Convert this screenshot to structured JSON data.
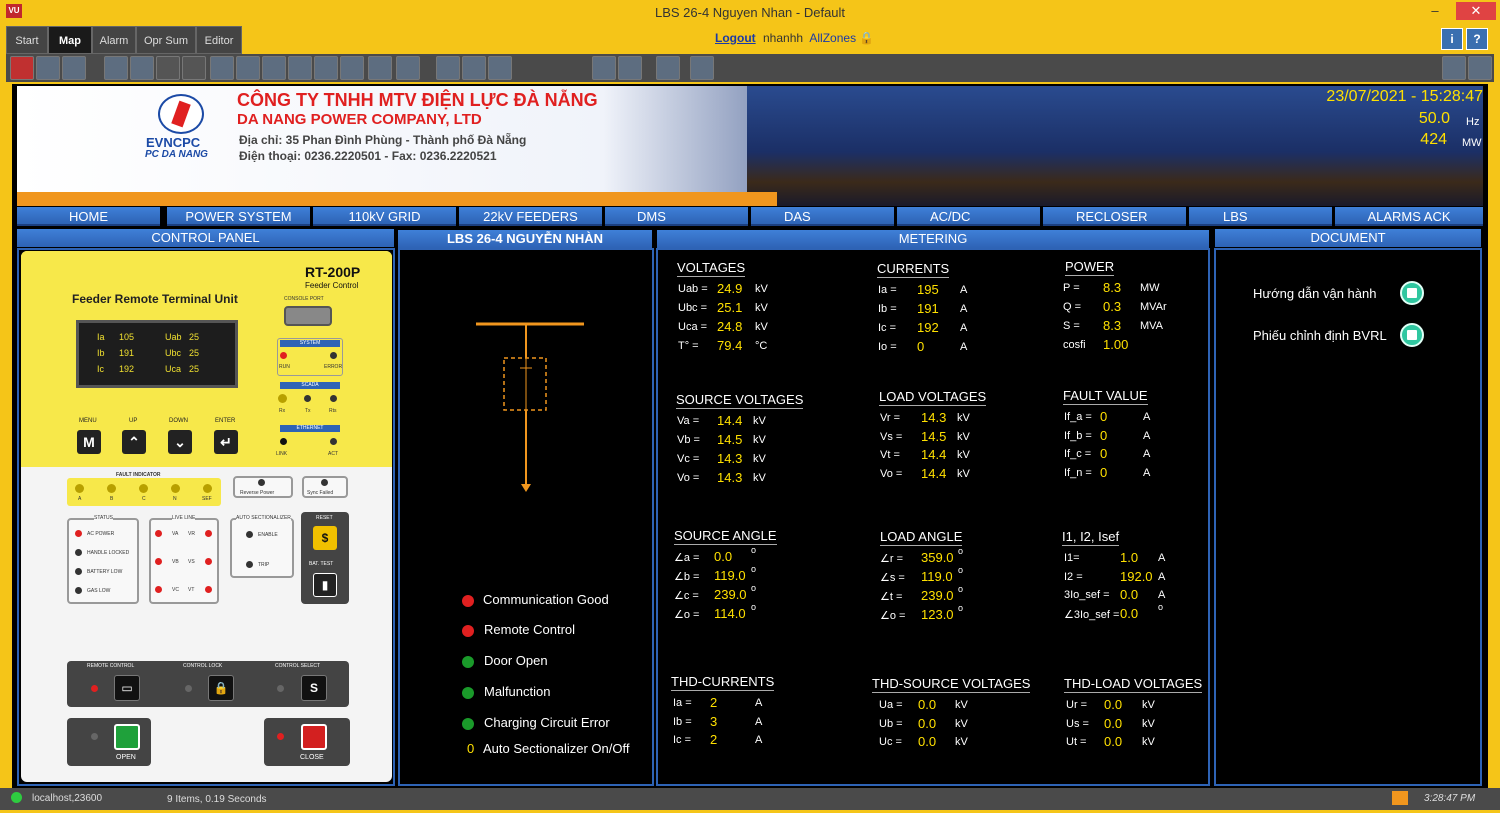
{
  "window": {
    "title": "LBS 26-4 Nguyen Nhan - Default",
    "app_icon": "VU"
  },
  "tabs": [
    {
      "label": "Start"
    },
    {
      "label": "Map"
    },
    {
      "label": "Alarm"
    },
    {
      "label": "Opr Sum"
    },
    {
      "label": "Editor"
    }
  ],
  "user": {
    "logout": "Logout",
    "name": "nhanhh",
    "zones": "AllZones"
  },
  "banner": {
    "company_vn": "CÔNG TY TNHH MTV ĐIỆN LỰC ĐÀ NẴNG",
    "company_en": "DA NANG POWER COMPANY, LTD",
    "address": "Địa chỉ: 35 Phan Đình Phùng - Thành phố Đà Nẵng",
    "phone": "Điện thoại: 0236.2220501 - Fax: 0236.2220521",
    "logo_line1": "EVNCPC",
    "logo_line2": "PC DA NANG",
    "datetime": "23/07/2021 - 15:28:47",
    "freq": "50.0",
    "freq_unit": "Hz",
    "power": "424",
    "power_unit": "MW"
  },
  "nav": [
    {
      "label": "HOME"
    },
    {
      "label": "POWER SYSTEM"
    },
    {
      "label": "110kV GRID"
    },
    {
      "label": "22kV FEEDERS"
    },
    {
      "label": "DMS"
    },
    {
      "label": "DAS"
    },
    {
      "label": "AC/DC"
    },
    {
      "label": "RECLOSER"
    },
    {
      "label": "LBS"
    },
    {
      "label": "ALARMS ACK"
    }
  ],
  "panels": {
    "control": "CONTROL PANEL",
    "device": "LBS 26-4 NGUYỄN NHÀN",
    "metering": "METERING",
    "document": "DOCUMENT"
  },
  "rtu": {
    "title": "Feeder Remote Terminal Unit",
    "model": "RT-200P",
    "model_sub": "Feeder Control",
    "console": "CONSOLE PORT",
    "lcd": [
      {
        "l": "Ia",
        "v": "105",
        "l2": "Uab",
        "v2": "25"
      },
      {
        "l": "Ib",
        "v": "191",
        "l2": "Ubc",
        "v2": "25"
      },
      {
        "l": "Ic",
        "v": "192",
        "l2": "Uca",
        "v2": "25"
      }
    ],
    "keys": [
      {
        "label": "MENU",
        "glyph": "M"
      },
      {
        "label": "UP",
        "glyph": "⌃"
      },
      {
        "label": "DOWN",
        "glyph": "⌄"
      },
      {
        "label": "ENTER",
        "glyph": "↵"
      }
    ],
    "system": "SYSTEM",
    "run": "RUN",
    "error": "ERROR",
    "scada": "SCADA",
    "rx": "Rx",
    "tx": "Tx",
    "rts": "Rts",
    "ethernet": "ETHERNET",
    "link": "LINK",
    "act": "ACT",
    "fault_indicator": "FAULT INDICATOR",
    "fi": [
      "A",
      "B",
      "C",
      "N",
      "SEF"
    ],
    "reverse_power": "Reverse Power",
    "sync_failed": "Sync Failed",
    "status": "STATUS",
    "status_items": [
      "AC POWER",
      "HANDLE LOCKED",
      "BATTERY LOW",
      "GAS LOW"
    ],
    "live_line": "LIVE LINE",
    "ll": [
      "VA",
      "VR",
      "VB",
      "VS",
      "VC",
      "VT"
    ],
    "auto_sec": "AUTO SECTIONALIZER",
    "enable": "ENABLE",
    "trip": "TRIP",
    "reset": "RESET",
    "bat_test": "BAT. TEST",
    "remote_control": "REMOTE CONTROL",
    "control_lock": "CONTROL LOCK",
    "control_select": "CONTROL SELECT",
    "open": "OPEN",
    "close": "CLOSE"
  },
  "indicators": [
    {
      "label": "Communication Good",
      "color": "#e02020"
    },
    {
      "label": "Remote Control",
      "color": "#e02020"
    },
    {
      "label": "Door Open",
      "color": "#1a9a2a"
    },
    {
      "label": "Malfunction",
      "color": "#1a9a2a"
    },
    {
      "label": "Charging Circuit Error",
      "color": "#1a9a2a"
    },
    {
      "value": "0",
      "label": "Auto Sectionalizer On/Off"
    }
  ],
  "metering": {
    "voltages": {
      "title": "VOLTAGES",
      "rows": [
        {
          "l": "Uab =",
          "v": "24.9",
          "u": "kV"
        },
        {
          "l": "Ubc =",
          "v": "25.1",
          "u": "kV"
        },
        {
          "l": "Uca =",
          "v": "24.8",
          "u": "kV"
        },
        {
          "l": "T° =",
          "v": "79.4",
          "u": "°C"
        }
      ]
    },
    "currents": {
      "title": "CURRENTS",
      "rows": [
        {
          "l": "Ia =",
          "v": "195",
          "u": "A"
        },
        {
          "l": "Ib =",
          "v": "191",
          "u": "A"
        },
        {
          "l": "Ic =",
          "v": "192",
          "u": "A"
        },
        {
          "l": "Io =",
          "v": "0",
          "u": "A"
        }
      ]
    },
    "power": {
      "title": "POWER",
      "rows": [
        {
          "l": "P =",
          "v": "8.3",
          "u": "MW"
        },
        {
          "l": "Q =",
          "v": "0.3",
          "u": "MVAr"
        },
        {
          "l": "S =",
          "v": "8.3",
          "u": "MVA"
        },
        {
          "l": "cosfi",
          "v": "1.00",
          "u": ""
        }
      ]
    },
    "source_voltages": {
      "title": "SOURCE VOLTAGES",
      "rows": [
        {
          "l": "Va =",
          "v": "14.4",
          "u": "kV"
        },
        {
          "l": "Vb =",
          "v": "14.5",
          "u": "kV"
        },
        {
          "l": "Vc =",
          "v": "14.3",
          "u": "kV"
        },
        {
          "l": "Vo =",
          "v": "14.3",
          "u": "kV"
        }
      ]
    },
    "load_voltages": {
      "title": "LOAD VOLTAGES",
      "rows": [
        {
          "l": "Vr =",
          "v": "14.3",
          "u": "kV"
        },
        {
          "l": "Vs =",
          "v": "14.5",
          "u": "kV"
        },
        {
          "l": "Vt =",
          "v": "14.4",
          "u": "kV"
        },
        {
          "l": "Vo =",
          "v": "14.4",
          "u": "kV"
        }
      ]
    },
    "fault_value": {
      "title": "FAULT VALUE",
      "rows": [
        {
          "l": "If_a =",
          "v": "0",
          "u": "A"
        },
        {
          "l": "If_b =",
          "v": "0",
          "u": "A"
        },
        {
          "l": "If_c =",
          "v": "0",
          "u": "A"
        },
        {
          "l": "If_n =",
          "v": "0",
          "u": "A"
        }
      ]
    },
    "source_angle": {
      "title": "SOURCE ANGLE",
      "rows": [
        {
          "l": "∠a =",
          "v": "0.0",
          "u": "o"
        },
        {
          "l": "∠b =",
          "v": "119.0",
          "u": "o"
        },
        {
          "l": "∠c =",
          "v": "239.0",
          "u": "o"
        },
        {
          "l": "∠o =",
          "v": "114.0",
          "u": "o"
        }
      ]
    },
    "load_angle": {
      "title": "LOAD ANGLE",
      "rows": [
        {
          "l": "∠r =",
          "v": "359.0",
          "u": "o"
        },
        {
          "l": "∠s =",
          "v": "119.0",
          "u": "o"
        },
        {
          "l": "∠t =",
          "v": "239.0",
          "u": "o"
        },
        {
          "l": "∠o =",
          "v": "123.0",
          "u": "o"
        }
      ]
    },
    "i1i2": {
      "title": "I1, I2, Isef",
      "rows": [
        {
          "l": "I1=",
          "v": "1.0",
          "u": "A"
        },
        {
          "l": "I2 =",
          "v": "192.0",
          "u": "A"
        },
        {
          "l": "3Io_sef =",
          "v": "0.0",
          "u": "A"
        },
        {
          "l": "∠3Io_sef =",
          "v": "0.0",
          "u": "o"
        }
      ]
    },
    "thd_currents": {
      "title": "THD-CURRENTS",
      "rows": [
        {
          "l": "Ia =",
          "v": "2",
          "u": "A"
        },
        {
          "l": "Ib =",
          "v": "3",
          "u": "A"
        },
        {
          "l": "Ic =",
          "v": "2",
          "u": "A"
        }
      ]
    },
    "thd_source": {
      "title": "THD-SOURCE VOLTAGES",
      "rows": [
        {
          "l": "Ua =",
          "v": "0.0",
          "u": "kV"
        },
        {
          "l": "Ub =",
          "v": "0.0",
          "u": "kV"
        },
        {
          "l": "Uc =",
          "v": "0.0",
          "u": "kV"
        }
      ]
    },
    "thd_load": {
      "title": "THD-LOAD VOLTAGES",
      "rows": [
        {
          "l": "Ur =",
          "v": "0.0",
          "u": "kV"
        },
        {
          "l": "Us =",
          "v": "0.0",
          "u": "kV"
        },
        {
          "l": "Ut =",
          "v": "0.0",
          "u": "kV"
        }
      ]
    }
  },
  "documents": [
    {
      "label": "Hướng dẫn vận hành"
    },
    {
      "label": "Phiếu chỉnh định BVRL"
    }
  ],
  "status": {
    "host": "localhost,23600",
    "items": "9 Items, 0.19 Seconds",
    "time": "3:28:47 PM"
  },
  "toolbar_icons": [
    "alarm-bell-icon",
    "window-icon",
    "tile-icon",
    "globe-icon",
    "home-icon",
    "back-icon",
    "forward-icon",
    "zoom-in-icon",
    "zoom-out-icon",
    "fit-icon",
    "pan-icon",
    "search-icon",
    "3d-icon",
    "print-icon",
    "save-icon",
    "oms-icon",
    "dms-icon",
    "monitor-icon",
    "vu-icon",
    "list-icon",
    "pen-icon",
    "compass-icon",
    "trend-icon",
    "exit-icon"
  ]
}
